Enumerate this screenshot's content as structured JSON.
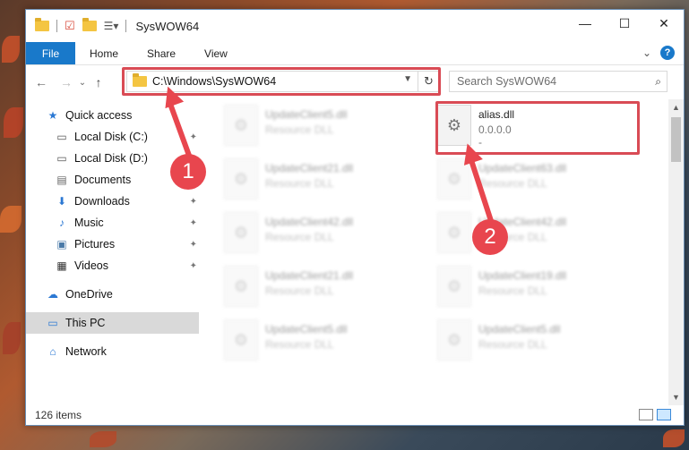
{
  "window": {
    "title": "SysWOW64",
    "controls": {
      "minimize": "—",
      "maximize": "☐",
      "close": "✕"
    }
  },
  "ribbon": {
    "tabs": [
      {
        "label": "File",
        "active": true
      },
      {
        "label": "Home"
      },
      {
        "label": "Share"
      },
      {
        "label": "View"
      }
    ],
    "expand_icon": "⌄",
    "help": "?"
  },
  "nav": {
    "back": "←",
    "forward": "→",
    "recent": "⌄",
    "up": "↑",
    "address": "C:\\Windows\\SysWOW64",
    "address_dropdown": "▼",
    "refresh": "↻",
    "search_placeholder": "Search SysWOW64",
    "search_icon": "⌕"
  },
  "sidebar": {
    "items": [
      {
        "label": "Quick access",
        "icon": "star-icon",
        "glyph": "★",
        "color": "#2b78d3"
      },
      {
        "label": "Local Disk (C:)",
        "icon": "drive-icon",
        "glyph": "▭",
        "pinned": true
      },
      {
        "label": "Local Disk (D:)",
        "icon": "drive-icon",
        "glyph": "▭"
      },
      {
        "label": "Documents",
        "icon": "documents-icon",
        "glyph": "▤",
        "pinned": true
      },
      {
        "label": "Downloads",
        "icon": "download-icon",
        "glyph": "⬇",
        "color": "#2b78d3",
        "pinned": true
      },
      {
        "label": "Music",
        "icon": "music-icon",
        "glyph": "♪",
        "color": "#2b78d3",
        "pinned": true
      },
      {
        "label": "Pictures",
        "icon": "pictures-icon",
        "glyph": "▣",
        "pinned": true
      },
      {
        "label": "Videos",
        "icon": "videos-icon",
        "glyph": "▦",
        "pinned": true
      },
      {
        "label": "OneDrive",
        "icon": "cloud-icon",
        "glyph": "☁",
        "color": "#2b78d3"
      },
      {
        "label": "This PC",
        "icon": "computer-icon",
        "glyph": "▭",
        "selected": true,
        "color": "#2b78d3"
      },
      {
        "label": "Network",
        "icon": "network-icon",
        "glyph": "⌂",
        "color": "#2b78d3"
      }
    ],
    "pin_glyph": "✦"
  },
  "files": {
    "left_column": [
      {
        "name": "UpdateClient5.dll",
        "type": "Resource DLL"
      },
      {
        "name": "UpdateClient21.dll",
        "type": "Resource DLL"
      },
      {
        "name": "UpdateClient42.dll",
        "type": "Resource DLL"
      },
      {
        "name": "UpdateClient21.dll",
        "type": "Resource DLL"
      },
      {
        "name": "UpdateClient5.dll",
        "type": "Resource DLL"
      }
    ],
    "right_column": [
      {
        "name": "alias.dll",
        "type": "0.0.0.0",
        "extra": "-",
        "highlighted": true
      },
      {
        "name": "UpdateClient63.dll",
        "type": "Resource DLL"
      },
      {
        "name": "UpdateClient42.dll",
        "type": "Resource DLL"
      },
      {
        "name": "UpdateClient19.dll",
        "type": "Resource DLL"
      },
      {
        "name": "UpdateClient5.dll",
        "type": "Resource DLL"
      }
    ],
    "file_icon_glyph": "⚙"
  },
  "status": {
    "item_count": "126 items"
  },
  "annotations": {
    "step1": "1",
    "step2": "2",
    "color": "#e8464e"
  }
}
